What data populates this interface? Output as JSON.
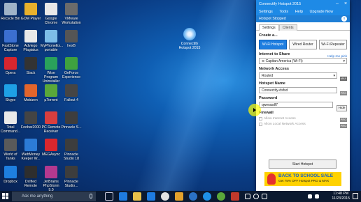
{
  "desktop": {
    "icons_col1": [
      {
        "label": "Recycle Bin",
        "icon": "recycle-bin-icon",
        "color": "#9fb3c8"
      },
      {
        "label": "FastStone Capture",
        "icon": "faststone-icon",
        "color": "#3b6fd0"
      },
      {
        "label": "Opera",
        "icon": "opera-icon",
        "color": "#d6262e"
      },
      {
        "label": "Skype",
        "icon": "skype-icon",
        "color": "#1ea0e6"
      },
      {
        "label": "Total Command...",
        "icon": "total-commander-icon",
        "color": "#e9e9e9"
      },
      {
        "label": "World of Tanks",
        "icon": "world-of-tanks-icon",
        "color": "#5a5a5a"
      },
      {
        "label": "Dropbox",
        "icon": "dropbox-icon",
        "color": "#1e7fe0"
      }
    ],
    "icons_col2": [
      {
        "label": "GOM Player",
        "icon": "gom-player-icon",
        "color": "#e9b12c"
      },
      {
        "label": "Adviego Plagiatus",
        "icon": "adviego-icon",
        "color": "#e9e9e9"
      },
      {
        "label": "Slack",
        "icon": "slack-icon",
        "color": "#333"
      },
      {
        "label": "Mobizen",
        "icon": "mobizen-icon",
        "color": "#e2652c"
      },
      {
        "label": "Foobar2000",
        "icon": "foobar-icon",
        "color": "#444"
      },
      {
        "label": "WebMoney Keeper W...",
        "icon": "webmoney-icon",
        "color": "#2c7bd6"
      },
      {
        "label": "DxIfied Remote",
        "icon": "dxified-remote-icon",
        "color": "#2e2e2e"
      }
    ],
    "icons_col3": [
      {
        "label": "Google Chrome",
        "icon": "chrome-icon",
        "color": "#e8e8e8"
      },
      {
        "label": "MyPhoneEx... portable",
        "icon": "myphoneexplorer-icon",
        "color": "#7dbde8"
      },
      {
        "label": "Wise Program Uninstaller",
        "icon": "wise-uninstaller-icon",
        "color": "#2aa25b"
      },
      {
        "label": "µTorrent",
        "icon": "utorrent-icon",
        "color": "#5aa83a"
      },
      {
        "label": "PC Remote Receiver",
        "icon": "pc-remote-icon",
        "color": "#d83e3e"
      },
      {
        "label": "MEGAsync",
        "icon": "megasync-icon",
        "color": "#d9272e"
      },
      {
        "label": "JetBrains PhpStorm 9.0",
        "icon": "phpstorm-icon",
        "color": "#b3398f"
      }
    ],
    "icons_col4": [
      {
        "label": "VMware Workstation",
        "icon": "vmware-icon",
        "color": "#6b6b6b"
      },
      {
        "label": "hexB",
        "icon": "hexb-icon",
        "color": "#555"
      },
      {
        "label": "GeForce Experience",
        "icon": "geforce-icon",
        "color": "#3fa23f"
      },
      {
        "label": "Fallout 4",
        "icon": "fallout-icon",
        "color": "#454545"
      },
      {
        "label": "Pinnacle S...",
        "icon": "pinnacle-icon",
        "color": "#3d3d3d"
      },
      {
        "label": "Pinnacle Studio 18",
        "icon": "pinnacle-18-icon",
        "color": "#3d3d3d"
      },
      {
        "label": "Pinnacle Studio...",
        "icon": "pinnacle-studio-icon",
        "color": "#3d3d3d"
      }
    ],
    "center_icon": {
      "label": "Connectify Hotspot 2015",
      "icon": "connectify-desktop-icon"
    }
  },
  "taskbar": {
    "search_placeholder": "Ask me anything",
    "time": "11:48 PM",
    "date": "11/23/2015"
  },
  "app": {
    "title": "Connectify Hotspot 2015",
    "menu": [
      "Settings",
      "Tools",
      "Help",
      "Upgrade Now"
    ],
    "status": "Hotspot Stopped",
    "tabs": [
      "Settings",
      "Clients"
    ],
    "create_label": "Create a...",
    "modes": [
      "Wi-Fi Hotspot",
      "Wired Router",
      "Wi-Fi Repeater"
    ],
    "internet_label": "Internet to Share",
    "help_link": "Help me pick",
    "internet_value": "Capitan America (Wi-Fi)",
    "network_access_label": "Network Access",
    "network_access_value": "Routed",
    "max_badge": "MAX",
    "hotspot_name_label": "Hotspot Name",
    "hotspot_name_value": "Connectify-dsfsd",
    "pro_badge": "PRO",
    "password_label": "Password",
    "password_value": "qwerasdf7",
    "hide_label": "Hide",
    "firewall_label": "Firewall",
    "firewall_opt1": "Allow Internet Access",
    "firewall_opt2": "Allow Local Network Access",
    "start_label": "Start Hotspot",
    "ad_title": "BACK TO SCHOOL SALE",
    "ad_sub": "Get 75% OFF Hotspot PRO & MAX"
  }
}
